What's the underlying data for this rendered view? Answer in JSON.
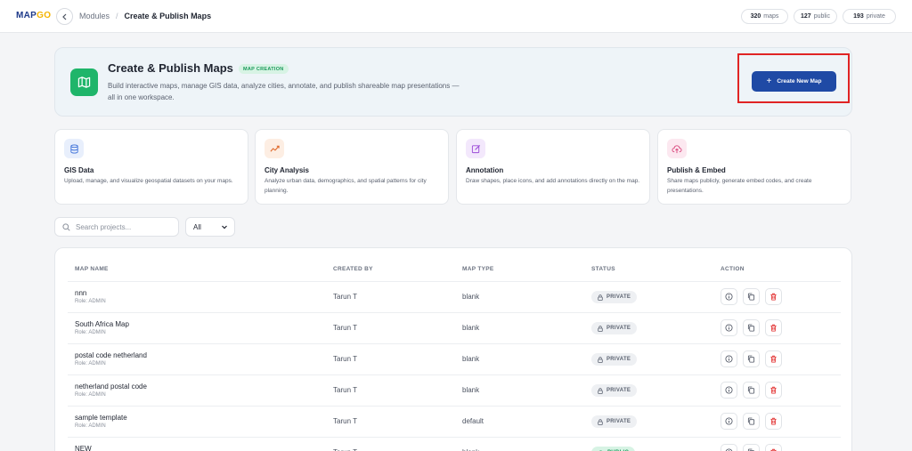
{
  "topbar": {
    "logo_text": "MAP",
    "logo_accent": "GO",
    "breadcrumb_parent": "Modules",
    "breadcrumb_separator": "/",
    "breadcrumb_current": "Create & Publish Maps",
    "stats": [
      {
        "count": "320",
        "label": "maps"
      },
      {
        "count": "127",
        "label": "public"
      },
      {
        "count": "193",
        "label": "private"
      }
    ]
  },
  "hero": {
    "title": "Create & Publish Maps",
    "badge": "MAP CREATION",
    "description": "Build interactive maps, manage GIS data, analyze cities, annotate, and publish shareable map presentations — all in one workspace.",
    "create_button": "Create New Map"
  },
  "features": [
    {
      "title": "GIS Data",
      "description": "Upload, manage, and visualize geospatial datasets on your maps.",
      "icon": "database-icon",
      "color": "#3b6fd8",
      "bg": "#e8effc"
    },
    {
      "title": "City Analysis",
      "description": "Analyze urban data, demographics, and spatial patterns for city planning.",
      "icon": "trend-icon",
      "color": "#e06a2c",
      "bg": "#fdeee3"
    },
    {
      "title": "Annotation",
      "description": "Draw shapes, place icons, and add annotations directly on the map.",
      "icon": "edit-icon",
      "color": "#9b4ad8",
      "bg": "#f3e8fc"
    },
    {
      "title": "Publish & Embed",
      "description": "Share maps publicly, generate embed codes, and create presentations.",
      "icon": "cloud-upload-icon",
      "color": "#d8437a",
      "bg": "#fce8f0"
    }
  ],
  "search": {
    "placeholder": "Search projects...",
    "value": ""
  },
  "filter": {
    "selected": "All"
  },
  "table": {
    "headers": [
      "MAP NAME",
      "CREATED BY",
      "MAP TYPE",
      "STATUS",
      "ACTION"
    ],
    "rows": [
      {
        "name": "nnn",
        "role": "Role: ADMIN",
        "created_by": "Tarun T",
        "type": "blank",
        "status": "PRIVATE",
        "status_kind": "private"
      },
      {
        "name": "South Africa Map",
        "role": "Role: ADMIN",
        "created_by": "Tarun T",
        "type": "blank",
        "status": "PRIVATE",
        "status_kind": "private"
      },
      {
        "name": "postal code netherland",
        "role": "Role: ADMIN",
        "created_by": "Tarun T",
        "type": "blank",
        "status": "PRIVATE",
        "status_kind": "private"
      },
      {
        "name": "netherland postal code",
        "role": "Role: ADMIN",
        "created_by": "Tarun T",
        "type": "blank",
        "status": "PRIVATE",
        "status_kind": "private"
      },
      {
        "name": "sample template",
        "role": "Role: ADMIN",
        "created_by": "Tarun T",
        "type": "default",
        "status": "PRIVATE",
        "status_kind": "private"
      },
      {
        "name": "NEW",
        "role": "Role: ADMIN",
        "created_by": "Tarun T",
        "type": "blank",
        "status": "PUBLIC",
        "status_kind": "public"
      }
    ]
  },
  "colors": {
    "primary": "#1f4aa5",
    "success": "#1fb56a",
    "danger": "#e02424"
  }
}
